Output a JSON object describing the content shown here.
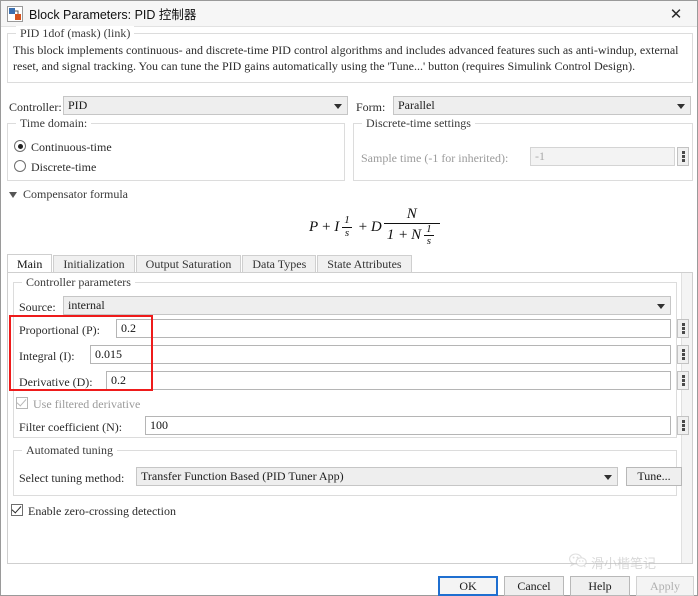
{
  "window": {
    "title": "Block Parameters: PID 控制器",
    "icon": "simulink-block-icon",
    "close_label": "✕"
  },
  "block_info": {
    "legend": "PID 1dof (mask) (link)",
    "description": "This block implements continuous- and discrete-time PID control algorithms and includes advanced features such as anti-windup, external reset, and signal tracking. You can tune the PID gains automatically using the 'Tune...' button (requires Simulink Control Design)."
  },
  "top_row": {
    "controller_label": "Controller:",
    "controller_value": "PID",
    "form_label": "Form:",
    "form_value": "Parallel"
  },
  "time_domain": {
    "legend": "Time domain:",
    "options": [
      {
        "label": "Continuous-time",
        "selected": true
      },
      {
        "label": "Discrete-time",
        "selected": false
      }
    ]
  },
  "discrete_settings": {
    "legend": "Discrete-time settings",
    "sample_time_label": "Sample time (-1 for inherited):",
    "sample_time_value": "-1",
    "enabled": false
  },
  "compensator": {
    "header": "Compensator formula",
    "expanded": true,
    "formula_parts": {
      "p": "P",
      "plus1": "+",
      "i": "I",
      "frac1_num": "1",
      "frac1_den": "s",
      "plus2": "+",
      "d": "D",
      "frac2_num": "N",
      "den_one": "1 +",
      "den_n": "N",
      "frac3_num": "1",
      "frac3_den": "s"
    }
  },
  "tabs": [
    {
      "label": "Main",
      "active": true
    },
    {
      "label": "Initialization",
      "active": false
    },
    {
      "label": "Output Saturation",
      "active": false
    },
    {
      "label": "Data Types",
      "active": false
    },
    {
      "label": "State Attributes",
      "active": false
    }
  ],
  "controller_parameters": {
    "legend": "Controller parameters",
    "source_label": "Source:",
    "source_value": "internal",
    "gains": [
      {
        "label": "Proportional (P):",
        "value": "0.2"
      },
      {
        "label": "Integral (I):",
        "value": "0.015"
      },
      {
        "label": "Derivative (D):",
        "value": "0.2"
      }
    ],
    "use_filtered_derivative": {
      "label": "Use filtered derivative",
      "checked": true,
      "enabled": false
    },
    "filter_coefficient": {
      "label": "Filter coefficient (N):",
      "value": "100"
    }
  },
  "automated_tuning": {
    "legend": "Automated tuning",
    "method_label": "Select tuning method:",
    "method_value": "Transfer Function Based (PID Tuner App)",
    "tune_button": "Tune..."
  },
  "zero_crossing": {
    "label": "Enable zero-crossing detection",
    "checked": true
  },
  "footer": {
    "ok": "OK",
    "cancel": "Cancel",
    "help": "Help",
    "apply": "Apply"
  },
  "watermark": {
    "icon": "wechat-icon",
    "text": "滑小楷笔记"
  },
  "annotation": {
    "color": "#ee1b1b",
    "target": "pid-gain-fields"
  }
}
